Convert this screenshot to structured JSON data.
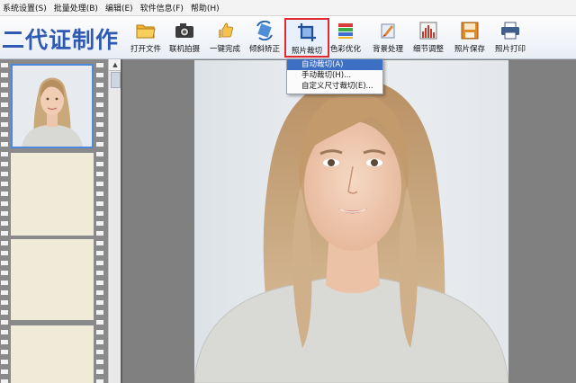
{
  "menu": [
    "系统设置(S)",
    "批量处理(B)",
    "编辑(E)",
    "软件信息(F)",
    "帮助(H)"
  ],
  "app_title": "二代证制作",
  "toolbar": {
    "open_file": "打开文件",
    "camera": "联机拍摄",
    "one_click": "一键完成",
    "deskew": "倾斜矫正",
    "crop": "照片裁切",
    "color": "色彩优化",
    "background": "背景处理",
    "detail": "细节调整",
    "save": "照片保存",
    "print": "照片打印"
  },
  "crop_menu": [
    "自动裁切(A)",
    "手动裁切(H)...",
    "自定义尺寸裁切(E)..."
  ],
  "colors": {
    "accent": "#2f5ab4",
    "highlight": "#3d6fc4",
    "active_border": "#e0292e"
  }
}
